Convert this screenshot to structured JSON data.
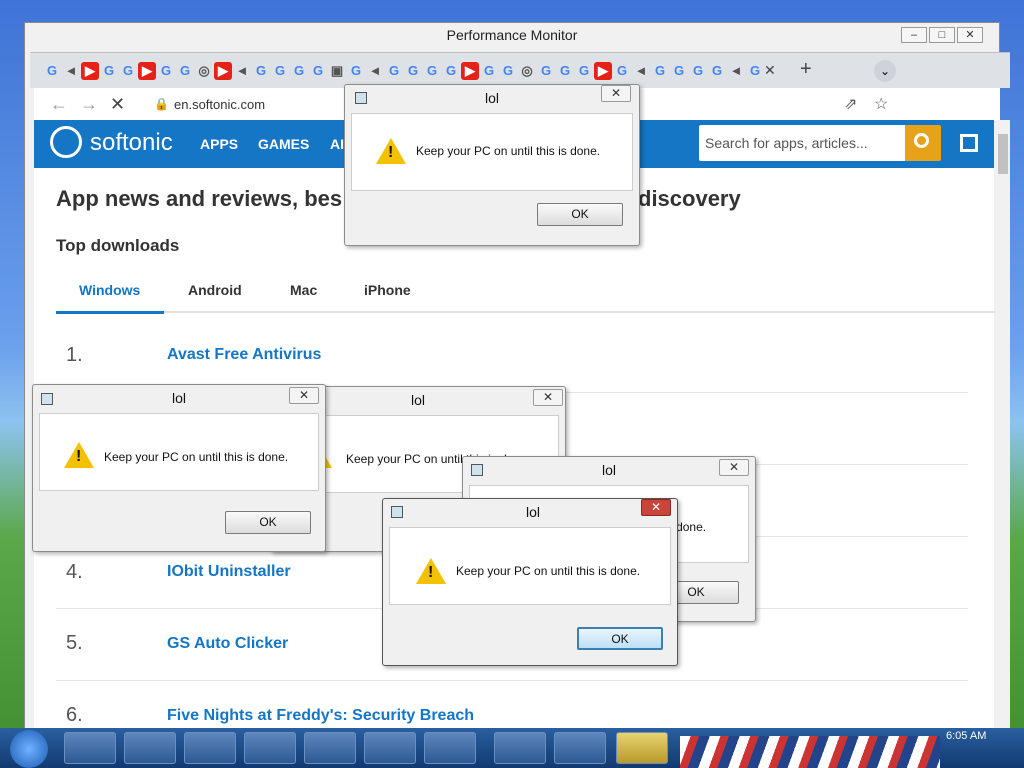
{
  "perf_window": {
    "title": "Performance Monitor"
  },
  "browser": {
    "url": "en.softonic.com",
    "tab_icons": [
      "G",
      "◄",
      "▶",
      "G",
      "G",
      "▶",
      "G",
      "G",
      "◎",
      "▶",
      "◄",
      "G",
      "G",
      "G",
      "G",
      "▣",
      "G",
      "◄",
      "G",
      "G",
      "G",
      "G",
      "▶",
      "G",
      "G",
      "◎",
      "G",
      "G",
      "G",
      "▶",
      "G",
      "◄",
      "G",
      "G",
      "G",
      "G",
      "◄",
      "G"
    ]
  },
  "site": {
    "logo": "softonic",
    "nav": [
      "APPS",
      "GAMES",
      "AI"
    ],
    "search_placeholder": "Search for apps, articles...",
    "heading_left": "App news and reviews, bes",
    "heading_right": "discovery",
    "section": "Top downloads",
    "tabs": [
      "Windows",
      "Android",
      "Mac",
      "iPhone"
    ],
    "downloads": [
      {
        "rank": "1.",
        "name": "Avast Free Antivirus"
      },
      {
        "rank": "4.",
        "name": "IObit Uninstaller"
      },
      {
        "rank": "5.",
        "name": "GS Auto Clicker"
      },
      {
        "rank": "6.",
        "name": "Five Nights at Freddy's: Security Breach"
      }
    ]
  },
  "dialogs": {
    "title": "lol",
    "message": "Keep your PC on until this is done.",
    "ok": "OK",
    "close": "✕"
  },
  "taskbar": {
    "clock": "6:05 AM"
  },
  "colors": {
    "accent": "#1476c4",
    "search_btn": "#e6a31a",
    "warning": "#f2c200"
  }
}
